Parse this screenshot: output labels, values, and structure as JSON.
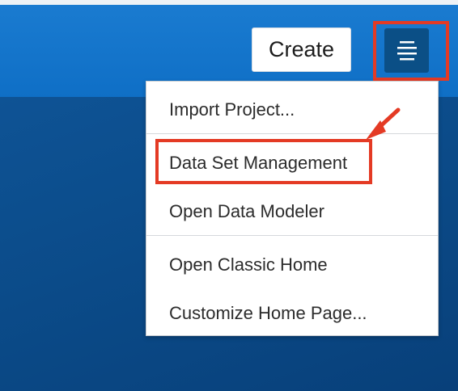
{
  "header": {
    "create_label": "Create",
    "menu_icon": "hamburger-menu-icon"
  },
  "menu": {
    "items": [
      {
        "label": "Import Project..."
      },
      {
        "label": "Data Set Management"
      },
      {
        "label": "Open Data Modeler"
      },
      {
        "label": "Open Classic Home"
      },
      {
        "label": "Customize Home Page..."
      }
    ]
  },
  "colors": {
    "header_blue": "#1a7bd0",
    "page_background": "#0b4b89",
    "menu_button": "#0b4f86",
    "annotation_red": "#e43a24"
  }
}
